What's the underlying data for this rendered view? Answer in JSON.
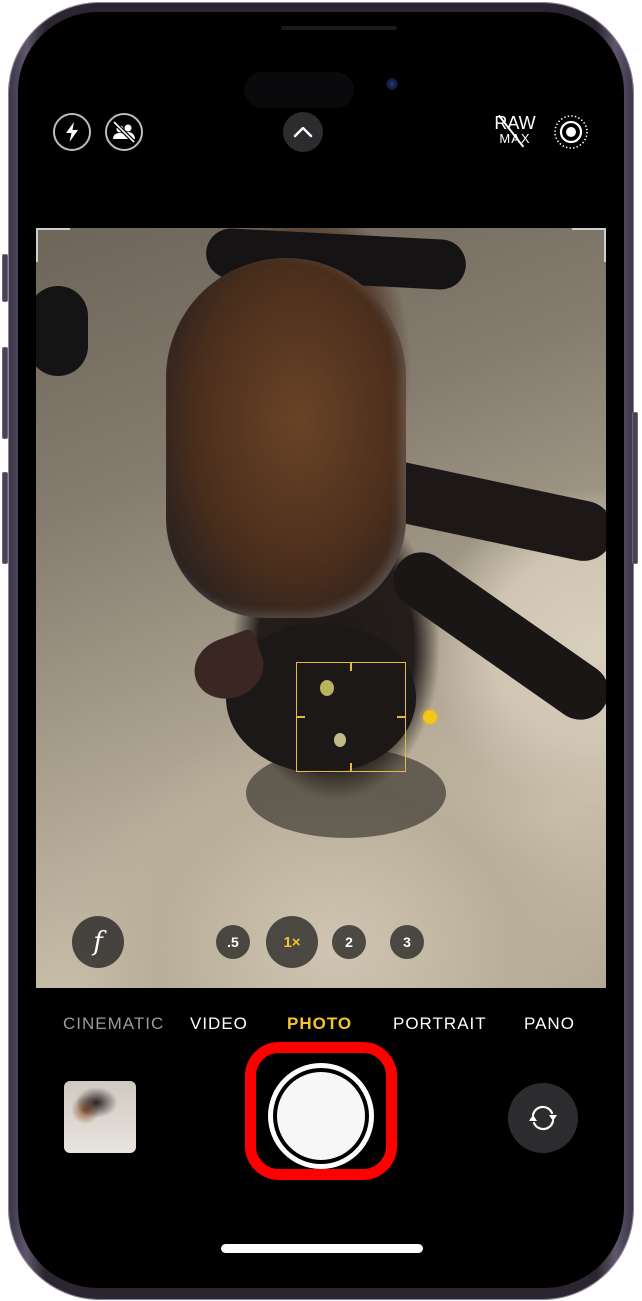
{
  "top_controls": {
    "flash": "flash-icon",
    "live_photo_off": "live-photo-off-icon",
    "expand": "chevron-up-icon",
    "raw_label": "RAW",
    "raw_sub_label": "MAX",
    "live_photo": "live-photo-icon"
  },
  "viewfinder": {
    "subject": "black cat lying on carpet",
    "focus_box_color": "#e6bb3c",
    "exposure_icon": "sun-icon"
  },
  "lens": {
    "aperture_label": "f",
    "options": [
      {
        "label": ".5",
        "active": false
      },
      {
        "label": "1×",
        "active": true
      },
      {
        "label": "2",
        "active": false
      },
      {
        "label": "3",
        "active": false
      }
    ],
    "active_color": "#f4c431"
  },
  "modes": [
    {
      "label": "CINEMATIC",
      "active": false
    },
    {
      "label": "VIDEO",
      "active": false
    },
    {
      "label": "PHOTO",
      "active": true
    },
    {
      "label": "PORTRAIT",
      "active": false
    },
    {
      "label": "PANO",
      "active": false
    }
  ],
  "bottom_controls": {
    "thumbnail": "last-photo-thumbnail",
    "shutter": "shutter-button",
    "flip": "camera-flip-icon",
    "highlight_color": "#ff0000"
  }
}
